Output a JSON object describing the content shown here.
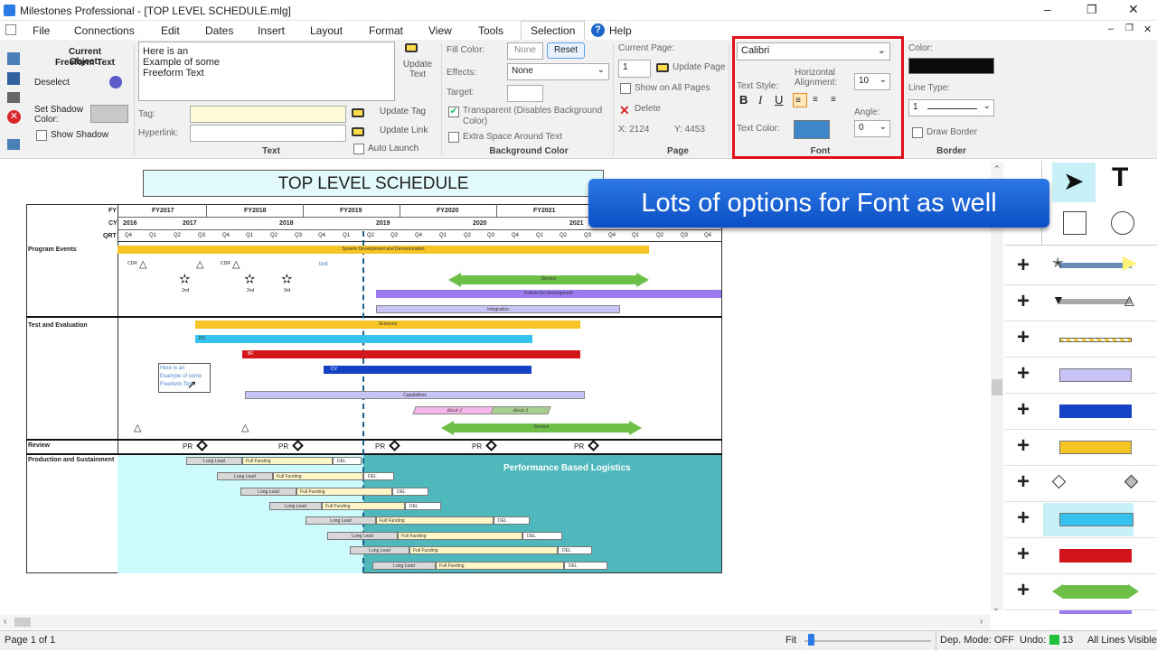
{
  "window": {
    "title": "Milestones Professional - [TOP LEVEL SCHEDULE.mlg]",
    "min": "–",
    "max": "❐",
    "close": "✕"
  },
  "menu": {
    "items": [
      "File",
      "Connections",
      "Edit",
      "Dates",
      "Insert",
      "Layout",
      "Format",
      "View",
      "Tools",
      "Selection",
      "Help"
    ],
    "doc_min": "–",
    "doc_max": "❐",
    "doc_close": "✕"
  },
  "ribbon": {
    "current_object_title": "Current Object:",
    "current_object_type": "Freeform Text",
    "deselect": "Deselect",
    "set_shadow_color": "Set Shadow Color:",
    "show_shadow": "Show Shadow",
    "text_box": [
      "Here is an",
      "Example of some",
      "Freeform Text"
    ],
    "update_text": "Update Text",
    "tag_label": "Tag:",
    "hyperlink_label": "Hyperlink:",
    "update_tag": "Update Tag",
    "update_link": "Update Link",
    "auto_launch": "Auto Launch",
    "text_group": "Text",
    "fill_color_label": "Fill Color:",
    "fill_value": "None",
    "reset": "Reset",
    "effects_label": "Effects:",
    "effects_value": "None",
    "target_label": "Target:",
    "transparent": "Transparent (Disables Background Color)",
    "extra_space": "Extra Space Around Text",
    "background_group": "Background Color",
    "current_page_label": "Current Page:",
    "current_page_value": "1",
    "update_page": "Update Page",
    "show_all_pages": "Show on All Pages",
    "delete": "Delete",
    "x_coord": "X: 2124",
    "y_coord": "Y: 4453",
    "page_group": "Page",
    "font_name": "Calibri",
    "text_style_label": "Text Style:",
    "bold": "B",
    "italic": "I",
    "underline": "U",
    "horiz_align_label": "Horizontal Alignment:",
    "font_size": "10",
    "text_color_label": "Text Color:",
    "angle_label": "Angle:",
    "angle_value": "0",
    "font_group": "Font",
    "color_label": "Color:",
    "line_type_label": "Line Type:",
    "line_type_value": "1",
    "draw_border": "Draw Border",
    "border_group": "Border"
  },
  "schedule": {
    "title": "TOP LEVEL SCHEDULE",
    "row_labels": {
      "fy": "FY",
      "cy": "CY",
      "qrt": "QRT"
    },
    "fy": [
      "FY2017",
      "FY2018",
      "FY2019",
      "FY2020",
      "FY2021"
    ],
    "cy": [
      "2016",
      "2017",
      "2018",
      "2019",
      "2020",
      "2021"
    ],
    "qrt": [
      "Q4",
      "Q1",
      "Q2",
      "Q3",
      "Q4",
      "Q1",
      "Q2",
      "Q3",
      "Q4",
      "Q1",
      "Q2",
      "Q3",
      "Q4",
      "Q1",
      "Q2",
      "Q3",
      "Q4",
      "Q1",
      "Q2",
      "Q3",
      "Q4",
      "Q1",
      "Q2",
      "Q3",
      "Q4"
    ],
    "sections": [
      "Program Events",
      "Test and Evaluation",
      "Review",
      "Production and Sustainment"
    ],
    "bars": {
      "sdd": "System Development and Demonstration",
      "service": "Service",
      "fod": "Follow-On Development",
      "integration": "Integration",
      "sciences": "Sciences",
      "ds": "DS",
      "bf": "BF",
      "cv": "CV",
      "capabilities": "Capabilities",
      "block2": "Block 2",
      "block3": "Block 3",
      "service2": "Service"
    },
    "milestones": {
      "cdr": "CDR",
      "cdr2": "CDR",
      "text": "text",
      "star1": "2nd",
      "star2": "2nd",
      "star3": "3rd"
    },
    "review": "PR",
    "freeform": [
      "Here is an",
      "Example of some",
      "Freeform Text"
    ],
    "pbl": "Performance Based Logistics",
    "prod_labels": {
      "ll": "Long Lead",
      "ff": "Full Funding",
      "del": "DEL"
    }
  },
  "callout": "Lots of options for Font as well",
  "status": {
    "page": "Page 1 of 1",
    "fit": "Fit",
    "dep_mode": "Dep. Mode: OFF",
    "undo_label": "Undo:",
    "undo_value": "13",
    "all_lines": "All Lines Visible"
  },
  "colors": {
    "font_highlight": "#e0101b",
    "callout": "#1a5fd6",
    "yellow": "#f6c425",
    "cyan": "#35c3ee",
    "red": "#d2141b",
    "blue": "#1541c4",
    "green": "#6dbf48",
    "purple": "#9b7bf0",
    "lavender": "#c8c3f5",
    "teal": "#4eb8bd"
  }
}
